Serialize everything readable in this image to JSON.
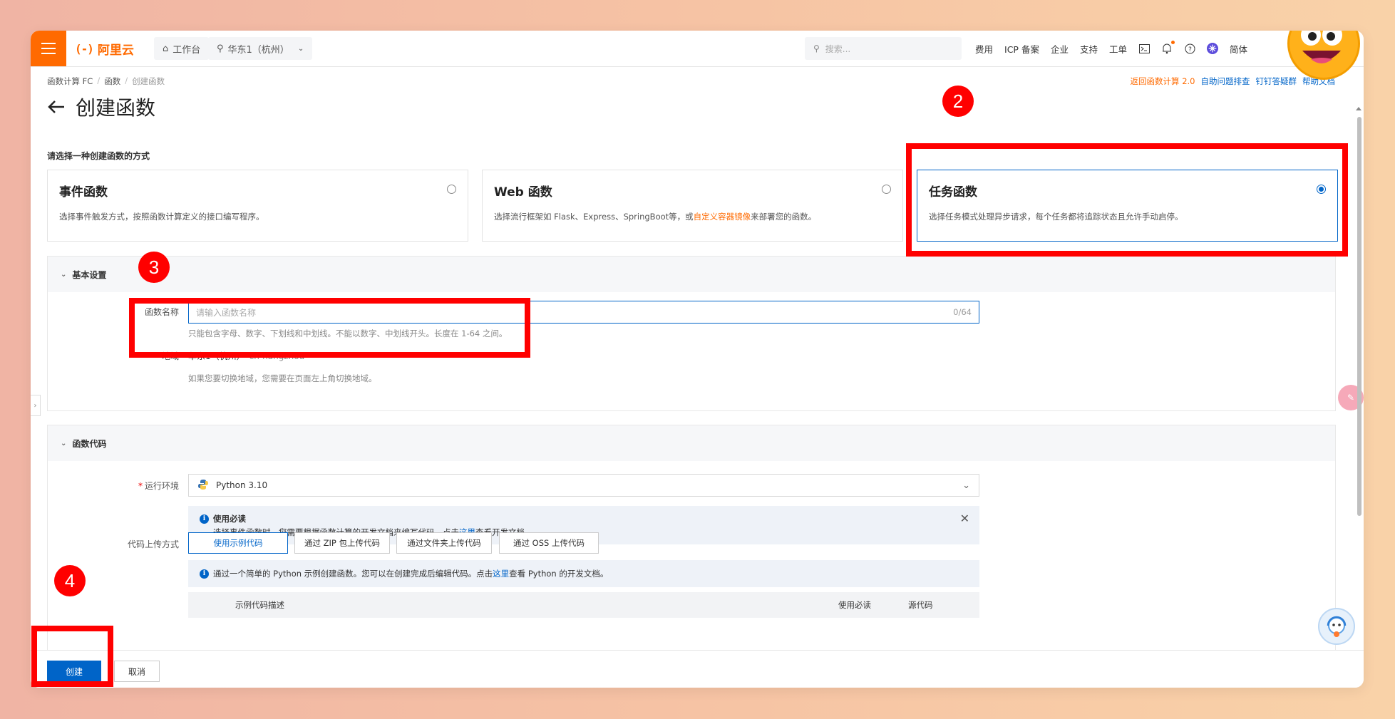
{
  "topbar": {
    "workbench": "工作台",
    "region": "华东1（杭州）",
    "search_placeholder": "搜索...",
    "nav": [
      "费用",
      "ICP 备案",
      "企业",
      "支持",
      "工单"
    ],
    "lang": "简体",
    "logo_text": "阿里云"
  },
  "breadcrumb": {
    "items": [
      "函数计算 FC",
      "函数",
      "创建函数"
    ]
  },
  "header_links": {
    "back_v2": "返回函数计算 2.0",
    "self_check": "自助问题排查",
    "dingding": "钉钉答疑群",
    "help_docs": "帮助文档"
  },
  "page": {
    "title": "创建函数",
    "subtitle": "请选择一种创建函数的方式"
  },
  "cards": [
    {
      "title": "事件函数",
      "desc": "选择事件触发方式，按照函数计算定义的接口编写程序。",
      "selected": false
    },
    {
      "title": "Web 函数",
      "desc_pre": "选择流行框架如 Flask、Express、SpringBoot等，或",
      "desc_highlight": "自定义容器镜像",
      "desc_post": "来部署您的函数。",
      "selected": false
    },
    {
      "title": "任务函数",
      "desc": "选择任务模式处理异步请求，每个任务都将追踪状态且允许手动启停。",
      "selected": true
    }
  ],
  "basic": {
    "title": "基本设置",
    "name_label": "函数名称",
    "name_placeholder": "请输入函数名称",
    "name_count": "0/64",
    "name_help": "只能包含字母、数字、下划线和中划线。不能以数字、中划线开头。长度在 1-64 之间。",
    "region_label": "地域",
    "region_value": "华东1（杭州）",
    "region_code": "cn-hangzhou",
    "region_help": "如果您要切换地域，您需要在页面左上角切换地域。"
  },
  "code": {
    "title": "函数代码",
    "runtime_label": "运行环境",
    "runtime_value": "Python 3.10",
    "notice_title": "使用必读",
    "notice_pre": "选择事件函数时，您需要根据函数计算的开发文档来编写代码。点击",
    "notice_link": "这里",
    "notice_post": "查看开发文档。",
    "upload_label": "代码上传方式",
    "upload_options": [
      "使用示例代码",
      "通过 ZIP 包上传代码",
      "通过文件夹上传代码",
      "通过 OSS 上传代码"
    ],
    "sample_pre": "通过一个简单的 Python 示例创建函数。您可以在创建完成后编辑代码。点击",
    "sample_link": "这里",
    "sample_post": "查看 Python 的开发文档。",
    "table_headers": [
      "示例代码描述",
      "使用必读",
      "源代码"
    ]
  },
  "footer": {
    "create": "创建",
    "cancel": "取消"
  },
  "annotations": [
    "2",
    "3",
    "4"
  ],
  "colors": {
    "brand": "#ff6a00",
    "primary": "#0064c8",
    "annotation": "#ff0000"
  }
}
